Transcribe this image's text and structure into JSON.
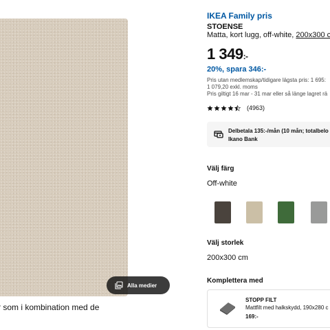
{
  "gallery": {
    "media_button_label": "Alla medier",
    "bottom_text": "r som i kombination med de"
  },
  "product": {
    "family_label": "IKEA Family pris",
    "name": "STOENSE",
    "description_prefix": "Matta, kort lugg, off-white, ",
    "description_size": "200x300 c",
    "price_main": "1 349",
    "price_suffix": ":-",
    "save_text": "20%, spara 346:-",
    "fineprint_line1": "Pris utan medlemskap/tidigare lägsta pris: 1 695:",
    "fineprint_line2": "1 079,20 exkl. moms",
    "fineprint_line3": "Pris giltigt 16 mar - 31 mar eller så länge lagret rä",
    "rating_value": 4.5,
    "rating_count": "(4963)"
  },
  "payment": {
    "line1": "Delbetala 135:-/mån (10 mån; totalbelo",
    "line2": "Ikano Bank",
    "icon": "payment-card-icon"
  },
  "color": {
    "label": "Välj färg",
    "value": "Off-white",
    "swatches": [
      {
        "name": "dark-grey",
        "color": "#4a433d"
      },
      {
        "name": "off-white",
        "color": "#cbbfa6"
      },
      {
        "name": "green",
        "color": "#3f6b3a"
      },
      {
        "name": "grey",
        "color": "#999a99"
      }
    ]
  },
  "size": {
    "label": "Välj storlek",
    "value": "200x300 cm"
  },
  "complement": {
    "label": "Komplettera med",
    "item_name": "STOPP FILT",
    "item_desc": "Mattfilt med halkskydd, 190x280 c",
    "item_price": "169:-"
  },
  "colors": {
    "brand_blue": "#0058a3",
    "text": "#111111",
    "rug": "#d7ccbc"
  }
}
